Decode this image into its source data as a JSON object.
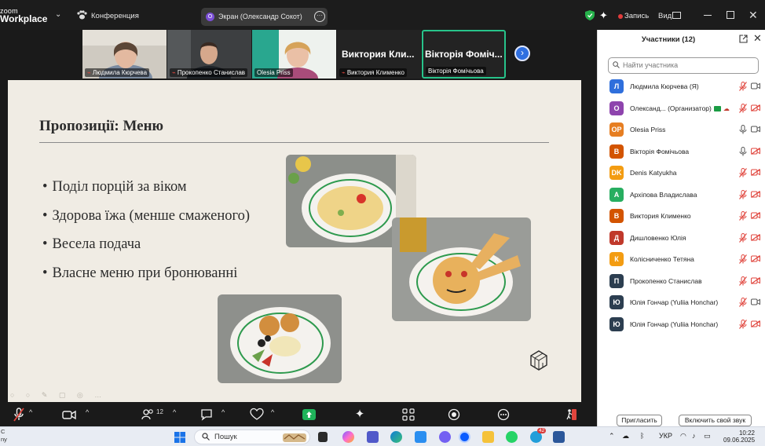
{
  "window": {
    "logo_line1": "zoom",
    "logo_line2": "Workplace",
    "meeting_menu_label": "Конференция",
    "share_pill_label": "Экран (Олександр Сокот)",
    "share_pill_icon": "O",
    "record_label": "Запись",
    "view_label": "Вид"
  },
  "thumbnails": [
    {
      "name": "Людмила Кюрчева",
      "muted": true,
      "kind": "video"
    },
    {
      "name": "Прокопенко Станислав",
      "muted": true,
      "kind": "video"
    },
    {
      "name": "Olesia Priss",
      "muted": false,
      "kind": "video"
    },
    {
      "name": "Виктория Клименко",
      "muted": true,
      "kind": "name",
      "big_label": "Виктория Кли..."
    },
    {
      "name": "Вікторія Фомічьова",
      "muted": false,
      "kind": "name",
      "big_label": "Вікторія Фоміч..."
    }
  ],
  "slide": {
    "title": "Пропозиції: Меню",
    "bullets": [
      "Поділ порцій за віком",
      "Здорова їжа (менше смаженого)",
      "Весела подача",
      "Власне меню при бронюванні"
    ],
    "tools_glyphs": "○ ○ ✎ ▢ ◎ …"
  },
  "controls": {
    "participants_count": "12"
  },
  "panel": {
    "title": "Участники (12)",
    "search_placeholder": "Найти участника",
    "invite_label": "Пригласить",
    "unmute_label": "Включить свой звук",
    "participants": [
      {
        "initial": "Л",
        "color": "#2f6fdc",
        "name": "Людмила Кюрчева (Я)",
        "mic": "muted",
        "cam": "on"
      },
      {
        "initial": "О",
        "color": "#8e44ad",
        "name": "Олександ... (Организатор)",
        "mic": "muted",
        "cam": "off",
        "host_badges": true
      },
      {
        "initial": "OP",
        "color": "#e67e22",
        "name": "Olesia Priss",
        "mic": "on",
        "cam": "on"
      },
      {
        "initial": "В",
        "color": "#d35400",
        "name": "Вікторія Фомічьова",
        "mic": "on",
        "cam": "off"
      },
      {
        "initial": "DK",
        "color": "#f39c12",
        "name": "Denis Katyukha",
        "mic": "muted",
        "cam": "off"
      },
      {
        "initial": "А",
        "color": "#27ae60",
        "name": "Архіпова Владислава",
        "mic": "muted",
        "cam": "off"
      },
      {
        "initial": "В",
        "color": "#d35400",
        "name": "Виктория Клименко",
        "mic": "muted",
        "cam": "off"
      },
      {
        "initial": "Д",
        "color": "#c0392b",
        "name": "Дишловенко Юлія",
        "mic": "muted",
        "cam": "off"
      },
      {
        "initial": "К",
        "color": "#f39c12",
        "name": "Колісниченко Тетяна",
        "mic": "muted",
        "cam": "off"
      },
      {
        "initial": "П",
        "color": "#2c3e50",
        "name": "Прокопенко Станислав",
        "mic": "muted",
        "cam": "off"
      },
      {
        "initial": "Ю",
        "color": "#2c3e50",
        "name": "Юлія Гончар (Yuliia Honchar)",
        "mic": "muted",
        "cam": "on"
      },
      {
        "initial": "Ю",
        "color": "#2c3e50",
        "name": "Юлія Гончар (Yuliia Honchar)",
        "mic": "muted",
        "cam": "off"
      }
    ]
  },
  "taskbar": {
    "search_label": "Пошук",
    "lang": "УКР",
    "time": "10:22",
    "date": "09.06.2025",
    "left_edge_line1": "C",
    "left_edge_line2": "ny",
    "badge_count": "42"
  }
}
